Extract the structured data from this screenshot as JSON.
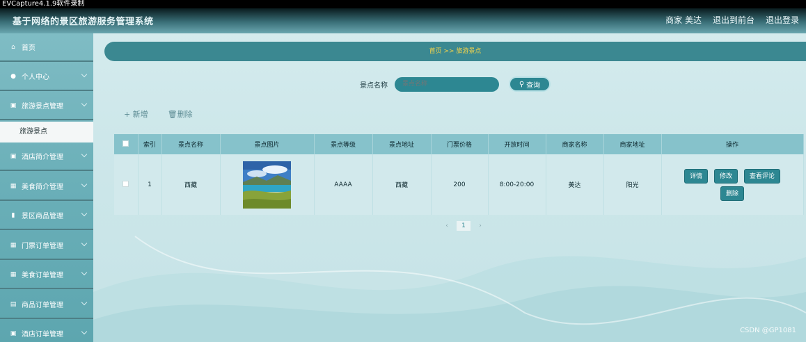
{
  "recording_label": "EVCapture4.1.9软件录制",
  "header": {
    "title": "基于网络的景区旅游服务管理系统",
    "nav": [
      "商家 美达",
      "退出到前台",
      "退出登录"
    ]
  },
  "sidebar": {
    "items": [
      {
        "label": "首页",
        "icon": "home-icon"
      },
      {
        "label": "个人中心",
        "icon": "user-icon"
      },
      {
        "label": "旅游景点管理",
        "icon": "clipboard-icon"
      },
      {
        "label": "酒店简介管理",
        "icon": "clipboard-icon"
      },
      {
        "label": "美食简介管理",
        "icon": "grid-icon"
      },
      {
        "label": "景区商品管理",
        "icon": "bar-chart-icon"
      },
      {
        "label": "门票订单管理",
        "icon": "grid-icon"
      },
      {
        "label": "美食订单管理",
        "icon": "grid-icon"
      },
      {
        "label": "商品订单管理",
        "icon": "chat-icon"
      },
      {
        "label": "酒店订单管理",
        "icon": "clipboard-icon"
      }
    ],
    "active_sub": "旅游景点"
  },
  "breadcrumb": "首页  >>  旅游景点",
  "search": {
    "label": "景点名称",
    "placeholder": "景点名称",
    "button": "查询"
  },
  "toolbar": {
    "add": "新增",
    "delete": "删除"
  },
  "table": {
    "headers": [
      "索引",
      "景点名称",
      "景点图片",
      "景点等级",
      "景点地址",
      "门票价格",
      "开放时间",
      "商家名称",
      "商家地址",
      "操作"
    ],
    "rows": [
      {
        "index": "1",
        "name": "西藏",
        "level": "AAAA",
        "address": "西藏",
        "price": "200",
        "hours": "8:00-20:00",
        "merchant": "美达",
        "merchant_addr": "阳光"
      }
    ],
    "ops": [
      "详情",
      "修改",
      "查看评论",
      "删除"
    ]
  },
  "pager": {
    "prev": "‹",
    "page": "1",
    "next": "›"
  },
  "watermark": "CSDN @GP1081"
}
